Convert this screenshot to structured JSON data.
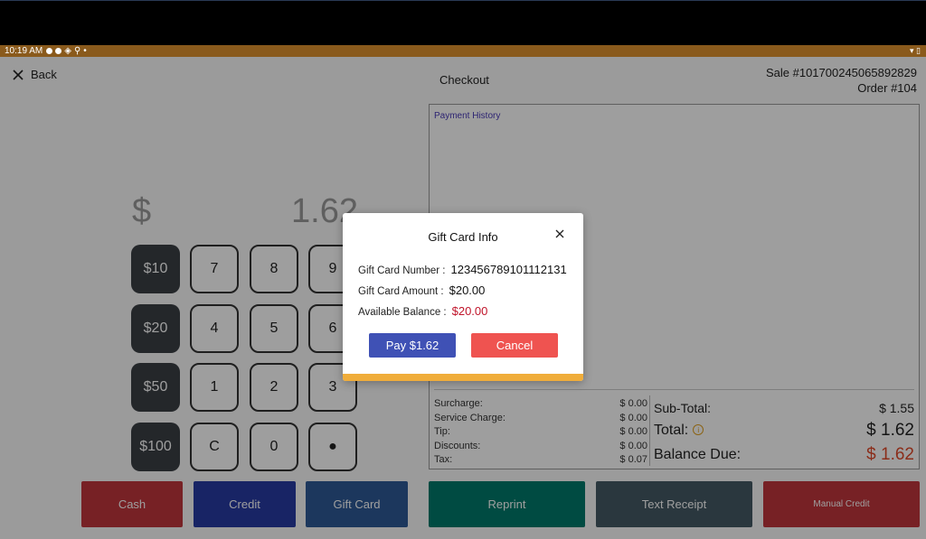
{
  "status_bar": {
    "time": "10:19 AM"
  },
  "header": {
    "back_label": "Back",
    "title": "Checkout",
    "sale_number": "Sale #101700245065892829",
    "order_number": "Order #104"
  },
  "amount_display": {
    "currency": "$",
    "value": "1.62"
  },
  "keypad": {
    "quick_amounts": [
      "$10",
      "$20",
      "$50",
      "$100"
    ],
    "rows": [
      [
        "7",
        "8",
        "9"
      ],
      [
        "4",
        "5",
        "6"
      ],
      [
        "1",
        "2",
        "3"
      ],
      [
        "C",
        "0",
        "●"
      ]
    ]
  },
  "payment_history": {
    "label": "Payment History",
    "breakdown": [
      {
        "label": "Surcharge:",
        "value": "$ 0.00"
      },
      {
        "label": "Service Charge:",
        "value": "$ 0.00"
      },
      {
        "label": "Tip:",
        "value": "$ 0.00"
      },
      {
        "label": "Discounts:",
        "value": "$ 0.00"
      },
      {
        "label": "Tax:",
        "value": "$ 0.07"
      }
    ],
    "subtotal_label": "Sub-Total:",
    "subtotal_value": "$ 1.55",
    "total_label": "Total:",
    "total_value": "$ 1.62",
    "balance_label": "Balance Due:",
    "balance_value": "$ 1.62"
  },
  "actions": {
    "cash": "Cash",
    "credit": "Credit",
    "gift_card": "Gift Card",
    "reprint": "Reprint",
    "text_receipt": "Text Receipt",
    "manual_credit": "Manual Credit"
  },
  "modal": {
    "title": "Gift Card Info",
    "number_label": "Gift Card Number :",
    "number_value": "123456789101112131",
    "amount_label": "Gift Card Amount :",
    "amount_value": "$20.00",
    "balance_label": "Available Balance :",
    "balance_value": "$20.00",
    "pay_label": "Pay $1.62",
    "cancel_label": "Cancel"
  },
  "colors": {
    "status_bar": "#8a5a1c",
    "cash": "#c0363d",
    "credit": "#283aa3",
    "gift_card": "#2e5a96",
    "reprint": "#00796b",
    "text_receipt": "#455a64",
    "manual_credit": "#c0363d",
    "pay": "#3f51b5",
    "cancel": "#ef5350",
    "balance_red": "#e04a2a"
  }
}
